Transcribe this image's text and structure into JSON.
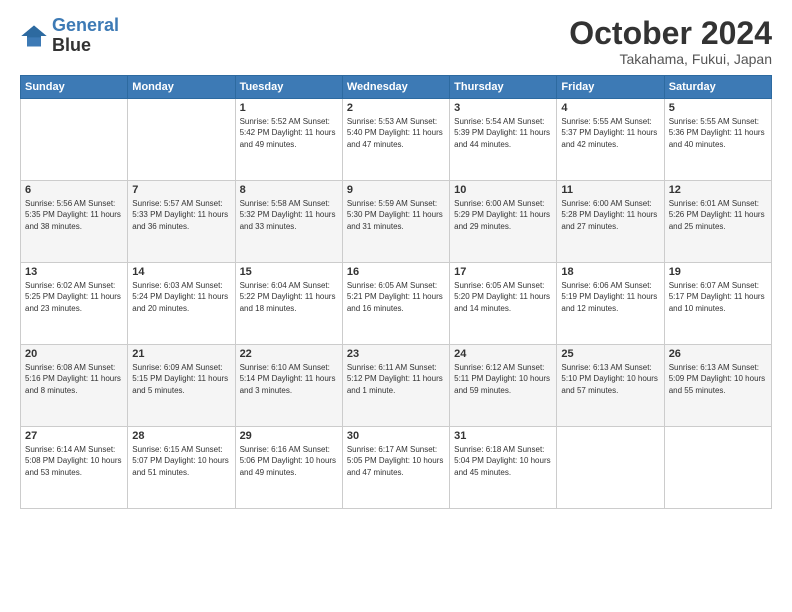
{
  "header": {
    "logo_line1": "General",
    "logo_line2": "Blue",
    "month": "October 2024",
    "location": "Takahama, Fukui, Japan"
  },
  "days_of_week": [
    "Sunday",
    "Monday",
    "Tuesday",
    "Wednesday",
    "Thursday",
    "Friday",
    "Saturday"
  ],
  "weeks": [
    [
      {
        "day": "",
        "info": ""
      },
      {
        "day": "",
        "info": ""
      },
      {
        "day": "1",
        "info": "Sunrise: 5:52 AM\nSunset: 5:42 PM\nDaylight: 11 hours and 49 minutes."
      },
      {
        "day": "2",
        "info": "Sunrise: 5:53 AM\nSunset: 5:40 PM\nDaylight: 11 hours and 47 minutes."
      },
      {
        "day": "3",
        "info": "Sunrise: 5:54 AM\nSunset: 5:39 PM\nDaylight: 11 hours and 44 minutes."
      },
      {
        "day": "4",
        "info": "Sunrise: 5:55 AM\nSunset: 5:37 PM\nDaylight: 11 hours and 42 minutes."
      },
      {
        "day": "5",
        "info": "Sunrise: 5:55 AM\nSunset: 5:36 PM\nDaylight: 11 hours and 40 minutes."
      }
    ],
    [
      {
        "day": "6",
        "info": "Sunrise: 5:56 AM\nSunset: 5:35 PM\nDaylight: 11 hours and 38 minutes."
      },
      {
        "day": "7",
        "info": "Sunrise: 5:57 AM\nSunset: 5:33 PM\nDaylight: 11 hours and 36 minutes."
      },
      {
        "day": "8",
        "info": "Sunrise: 5:58 AM\nSunset: 5:32 PM\nDaylight: 11 hours and 33 minutes."
      },
      {
        "day": "9",
        "info": "Sunrise: 5:59 AM\nSunset: 5:30 PM\nDaylight: 11 hours and 31 minutes."
      },
      {
        "day": "10",
        "info": "Sunrise: 6:00 AM\nSunset: 5:29 PM\nDaylight: 11 hours and 29 minutes."
      },
      {
        "day": "11",
        "info": "Sunrise: 6:00 AM\nSunset: 5:28 PM\nDaylight: 11 hours and 27 minutes."
      },
      {
        "day": "12",
        "info": "Sunrise: 6:01 AM\nSunset: 5:26 PM\nDaylight: 11 hours and 25 minutes."
      }
    ],
    [
      {
        "day": "13",
        "info": "Sunrise: 6:02 AM\nSunset: 5:25 PM\nDaylight: 11 hours and 23 minutes."
      },
      {
        "day": "14",
        "info": "Sunrise: 6:03 AM\nSunset: 5:24 PM\nDaylight: 11 hours and 20 minutes."
      },
      {
        "day": "15",
        "info": "Sunrise: 6:04 AM\nSunset: 5:22 PM\nDaylight: 11 hours and 18 minutes."
      },
      {
        "day": "16",
        "info": "Sunrise: 6:05 AM\nSunset: 5:21 PM\nDaylight: 11 hours and 16 minutes."
      },
      {
        "day": "17",
        "info": "Sunrise: 6:05 AM\nSunset: 5:20 PM\nDaylight: 11 hours and 14 minutes."
      },
      {
        "day": "18",
        "info": "Sunrise: 6:06 AM\nSunset: 5:19 PM\nDaylight: 11 hours and 12 minutes."
      },
      {
        "day": "19",
        "info": "Sunrise: 6:07 AM\nSunset: 5:17 PM\nDaylight: 11 hours and 10 minutes."
      }
    ],
    [
      {
        "day": "20",
        "info": "Sunrise: 6:08 AM\nSunset: 5:16 PM\nDaylight: 11 hours and 8 minutes."
      },
      {
        "day": "21",
        "info": "Sunrise: 6:09 AM\nSunset: 5:15 PM\nDaylight: 11 hours and 5 minutes."
      },
      {
        "day": "22",
        "info": "Sunrise: 6:10 AM\nSunset: 5:14 PM\nDaylight: 11 hours and 3 minutes."
      },
      {
        "day": "23",
        "info": "Sunrise: 6:11 AM\nSunset: 5:12 PM\nDaylight: 11 hours and 1 minute."
      },
      {
        "day": "24",
        "info": "Sunrise: 6:12 AM\nSunset: 5:11 PM\nDaylight: 10 hours and 59 minutes."
      },
      {
        "day": "25",
        "info": "Sunrise: 6:13 AM\nSunset: 5:10 PM\nDaylight: 10 hours and 57 minutes."
      },
      {
        "day": "26",
        "info": "Sunrise: 6:13 AM\nSunset: 5:09 PM\nDaylight: 10 hours and 55 minutes."
      }
    ],
    [
      {
        "day": "27",
        "info": "Sunrise: 6:14 AM\nSunset: 5:08 PM\nDaylight: 10 hours and 53 minutes."
      },
      {
        "day": "28",
        "info": "Sunrise: 6:15 AM\nSunset: 5:07 PM\nDaylight: 10 hours and 51 minutes."
      },
      {
        "day": "29",
        "info": "Sunrise: 6:16 AM\nSunset: 5:06 PM\nDaylight: 10 hours and 49 minutes."
      },
      {
        "day": "30",
        "info": "Sunrise: 6:17 AM\nSunset: 5:05 PM\nDaylight: 10 hours and 47 minutes."
      },
      {
        "day": "31",
        "info": "Sunrise: 6:18 AM\nSunset: 5:04 PM\nDaylight: 10 hours and 45 minutes."
      },
      {
        "day": "",
        "info": ""
      },
      {
        "day": "",
        "info": ""
      }
    ]
  ]
}
